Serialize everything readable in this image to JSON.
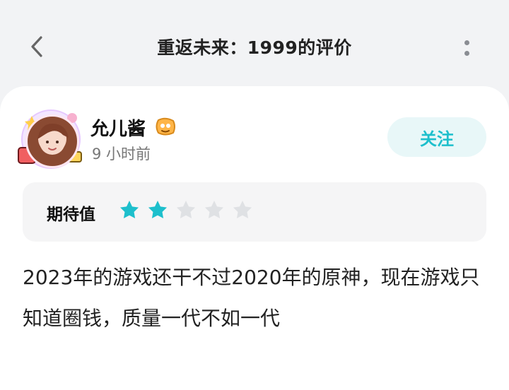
{
  "header": {
    "title": "重返未来：1999的评价"
  },
  "review": {
    "user": {
      "name": "允儿酱",
      "time": "9 小时前"
    },
    "follow_label": "关注",
    "rating": {
      "label": "期待值",
      "value": 2,
      "max": 5,
      "filled_color": "#1dbfcc",
      "empty_color": "#dfe1e4"
    },
    "text": "2023年的游戏还干不过2020年的原神，现在游戏只知道圈钱，质量一代不如一代"
  },
  "icons": {
    "back": "chevron-left-icon",
    "more": "more-vertical-icon",
    "badge": "level-badge-icon",
    "star": "star-icon"
  }
}
